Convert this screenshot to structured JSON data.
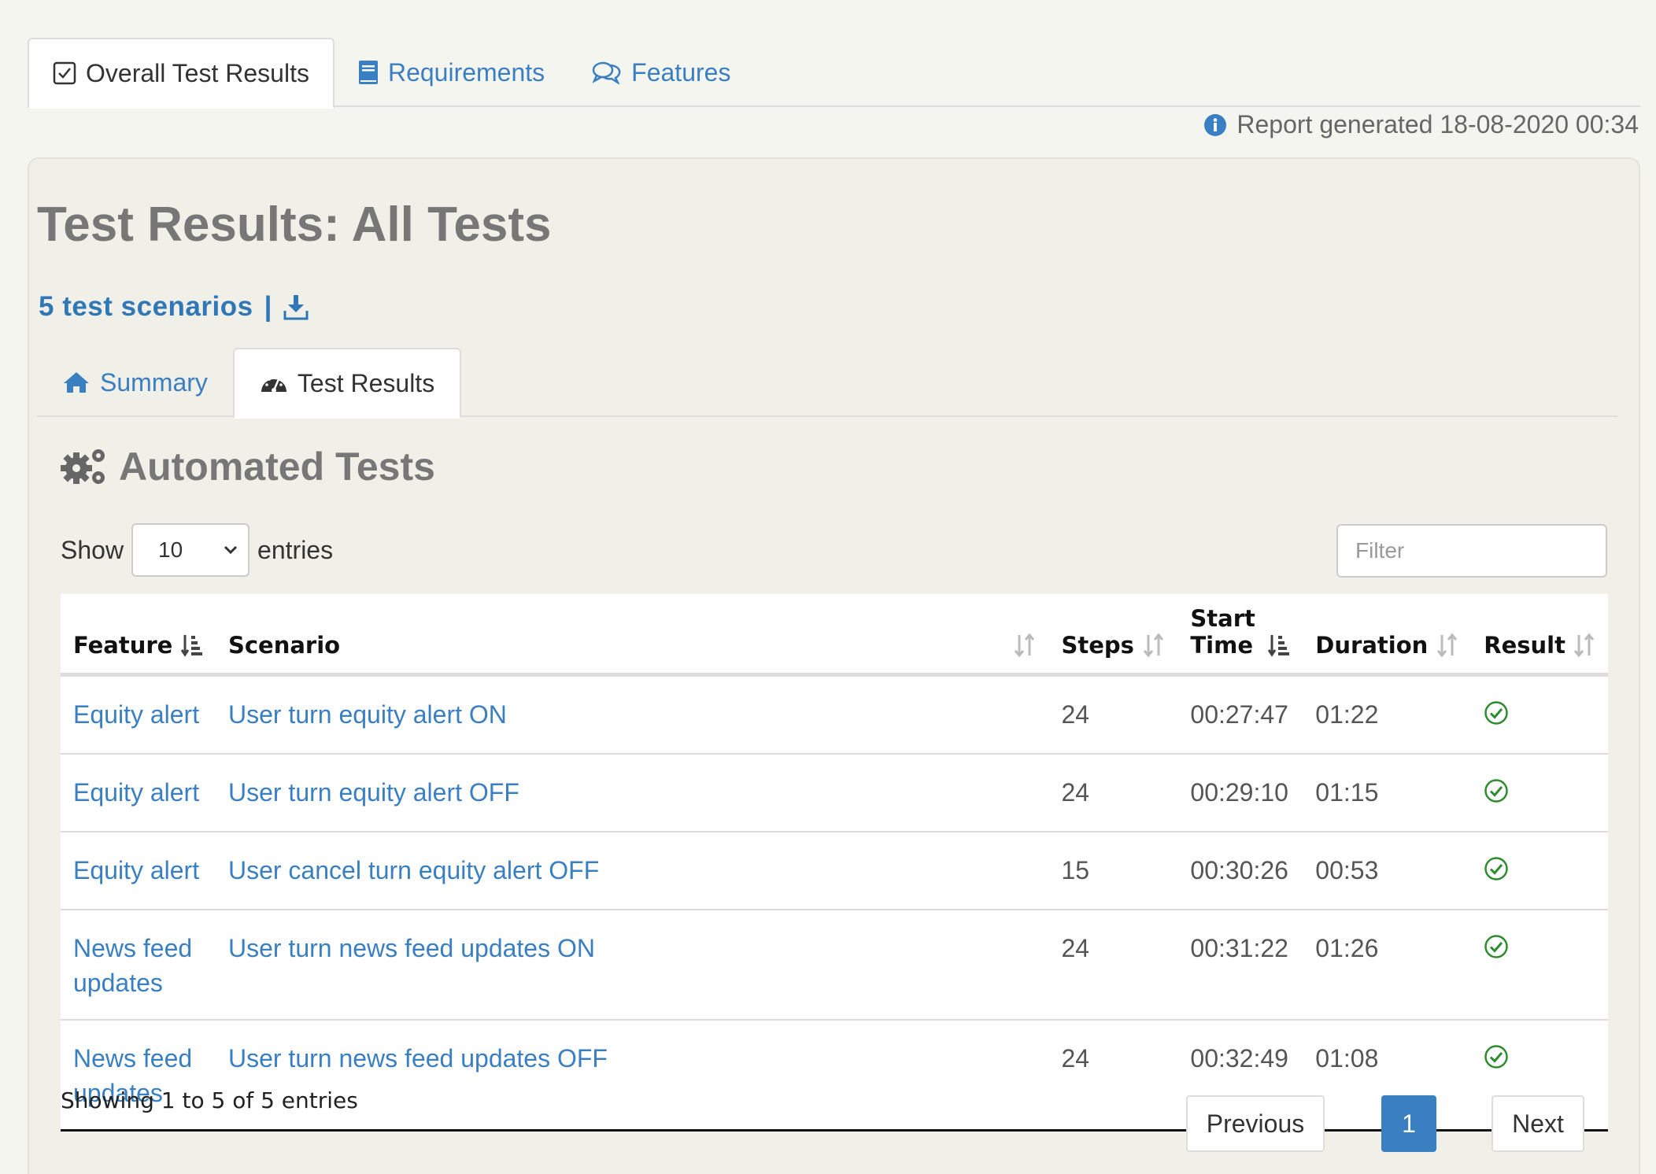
{
  "top_tabs": [
    {
      "label": "Overall Test Results",
      "icon": "checkbox-icon",
      "active": true
    },
    {
      "label": "Requirements",
      "icon": "book-icon",
      "active": false
    },
    {
      "label": "Features",
      "icon": "comments-icon",
      "active": false
    }
  ],
  "report": {
    "generated": "Report generated 18-08-2020 00:34"
  },
  "page": {
    "title": "Test Results: All Tests",
    "scenario_count": "5 test scenarios",
    "separator": "|"
  },
  "sub_tabs": [
    {
      "label": "Summary",
      "icon": "home-icon",
      "active": false
    },
    {
      "label": "Test Results",
      "icon": "speedometer-icon",
      "active": true
    }
  ],
  "section": {
    "title": "Automated Tests"
  },
  "controls": {
    "show_label": "Show",
    "entries_label": "entries",
    "page_length": "10",
    "filter_placeholder": "Filter"
  },
  "table": {
    "headers": [
      "Feature",
      "Scenario",
      "Steps",
      "Start Time",
      "Duration",
      "Result"
    ],
    "header_start_time": [
      "Start",
      "Time"
    ],
    "rows": [
      {
        "feature": "Equity alert",
        "scenario": "User turn equity alert ON",
        "steps": "24",
        "start": "00:27:47",
        "duration": "01:22",
        "result": "passed"
      },
      {
        "feature": "Equity alert",
        "scenario": "User turn equity alert OFF",
        "steps": "24",
        "start": "00:29:10",
        "duration": "01:15",
        "result": "passed"
      },
      {
        "feature": "Equity alert",
        "scenario": "User cancel turn equity alert OFF",
        "steps": "15",
        "start": "00:30:26",
        "duration": "00:53",
        "result": "passed"
      },
      {
        "feature": "News feed updates",
        "scenario": "User turn news feed updates ON",
        "steps": "24",
        "start": "00:31:22",
        "duration": "01:26",
        "result": "passed"
      },
      {
        "feature": "News feed updates",
        "scenario": "User turn news feed updates OFF",
        "steps": "24",
        "start": "00:32:49",
        "duration": "01:08",
        "result": "passed"
      }
    ]
  },
  "footer": {
    "info": "Showing 1 to 5 of 5 entries",
    "previous": "Previous",
    "current_page": "1",
    "next": "Next"
  },
  "colors": {
    "link": "#3a7fc1",
    "pass": "#2e8b2e",
    "page_bg": "#f5f5f0"
  }
}
